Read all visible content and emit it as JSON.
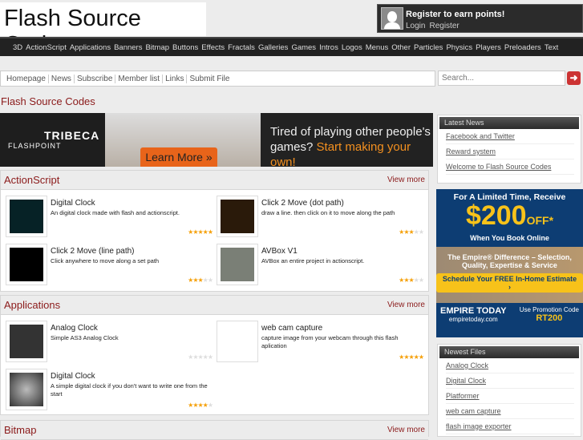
{
  "header": {
    "logo": "Flash Source Codes",
    "user": {
      "title": "Register to earn points!",
      "login": "Login",
      "register": "Register",
      "icon": "user-silhouette-icon"
    }
  },
  "nav": [
    "3D",
    "ActionScript",
    "Applications",
    "Banners",
    "Bitmap",
    "Buttons",
    "Effects",
    "Fractals",
    "Galleries",
    "Games",
    "Intros",
    "Logos",
    "Menus",
    "Other",
    "Particles",
    "Physics",
    "Players",
    "Preloaders",
    "Text"
  ],
  "breadcrumbs": [
    "Homepage",
    "News",
    "Subscribe",
    "Member list",
    "Links",
    "Submit File"
  ],
  "search": {
    "placeholder": "Search...",
    "button_icon": "arrow-right-icon",
    "button_glyph": "➜"
  },
  "page_title": "Flash Source Codes",
  "banner": {
    "brand_top": "TRIBECA",
    "brand_bottom": "FLASHPOINT",
    "cta": "Learn More »",
    "text": "Tired of playing other people's games?",
    "highlight": "Start making your own!"
  },
  "accent_color": "#8b1a1a",
  "sections": [
    {
      "title": "ActionScript",
      "more": "View more",
      "items": [
        {
          "title": "Digital Clock",
          "desc": "An digital clock made with flash and actionscript.",
          "rating": 5
        },
        {
          "title": "Click 2 Move (dot path)",
          "desc": "draw a line. then click on it to move along the path",
          "rating": 2.5
        },
        {
          "title": "Click 2 Move (line path)",
          "desc": "Click anywhere to move along a set path",
          "rating": 3
        },
        {
          "title": "AVBox V1",
          "desc": "AVBox an entire project in actionscript.",
          "rating": 2.5
        }
      ]
    },
    {
      "title": "Applications",
      "more": "View more",
      "items": [
        {
          "title": "Analog Clock",
          "desc": "Simple AS3 Analog Clock",
          "rating": 0
        },
        {
          "title": "web cam capture",
          "desc": "capture image from your webcam through this flash aplication",
          "rating": 5
        },
        {
          "title": "Digital Clock",
          "desc": "A simple digital clock if you don't want to write one from the start",
          "rating": 3.5
        }
      ]
    },
    {
      "title": "Bitmap",
      "more": "View more",
      "items": []
    }
  ],
  "sidebar": {
    "latest_news": {
      "title": "Latest News",
      "items": [
        "Facebook and Twitter",
        "Reward system",
        "Welcome to Flash Source Codes"
      ]
    },
    "ad": {
      "line1": "For A Limited Time, Receive",
      "amount": "$200",
      "off": "OFF*",
      "line3": "When You Book Online",
      "line4": "The Empire® Difference – Selection, Quality, Expertise & Service",
      "cta": "Schedule Your FREE In-Home Estimate ›",
      "brand": "EMPIRE TODAY",
      "site": "empiretoday.com",
      "promo": "Use Promotion Code",
      "code": "RT200"
    },
    "newest_files": {
      "title": "Newest Files",
      "items": [
        "Analog Clock",
        "Digital Clock",
        "Platformer",
        "web cam capture",
        "flash image exporter"
      ]
    }
  }
}
